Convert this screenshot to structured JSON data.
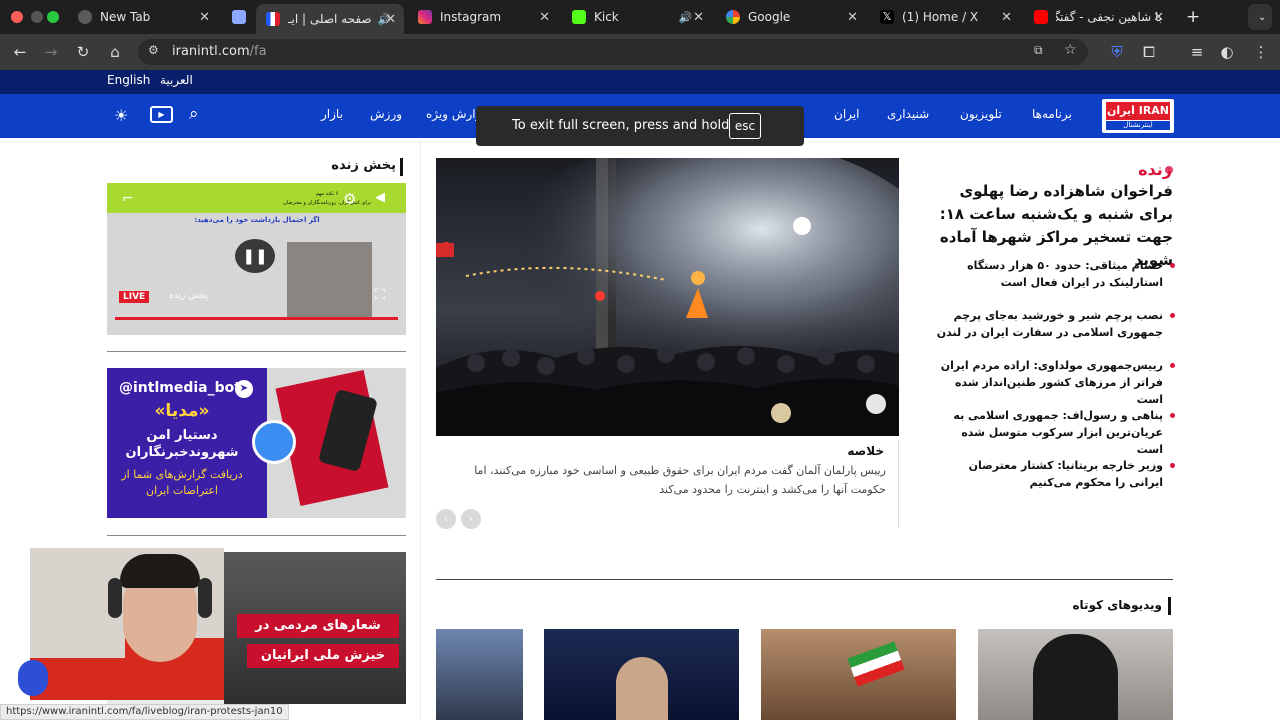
{
  "browser": {
    "tabs": [
      {
        "title": "New Tab",
        "active": false
      },
      {
        "title": "",
        "active": false
      },
      {
        "title": "صفحه اصلی | ایـ",
        "active": true
      },
      {
        "title": "Instagram",
        "active": false
      },
      {
        "title": "Kick",
        "active": false
      },
      {
        "title": "Google",
        "active": false
      },
      {
        "title": "(1) Home / X",
        "active": false
      },
      {
        "title": "با شاهین نجفی - گفتگ",
        "active": false
      }
    ],
    "url_host": "iranintl.com",
    "url_path": "/fa",
    "status_url": "https://www.iranintl.com/fa/liveblog/iran-protests-jan10"
  },
  "site": {
    "langs": [
      "English",
      "العربية"
    ],
    "nav": [
      "برنامه‌ها",
      "تلویزیون",
      "شنیداری",
      "ایران",
      "گزارش ویژه",
      "ورزش",
      "بازار"
    ],
    "logo_top": "ایران IRAN",
    "logo_bottom": "اینترنشنال"
  },
  "fullscreen_toast": {
    "text": "To exit full screen, press and hold",
    "key": "esc"
  },
  "live": {
    "label": "زنده",
    "headline": "فراخوان شاهزاده رضا پهلوی برای شنبه و یک‌شنبه ساعت ۱۸: جهت تسخیر مراکز شهرها آماده شوید",
    "bullets": [
      "حسام میثاقی: حدود ۵۰ هزار دستگاه استارلینک در ایران فعال است",
      "نصب پرچم شیر و خورشید به‌جای پرچم جمهوری اسلامی در سفارت ایران در لندن",
      "رییس‌جمهوری مولداوی: اراده مردم ایران فراتر از مرزهای کشور طنین‌انداز شده است",
      "پناهی و رسول‌اف: جمهوری اسلامی به عریان‌ترین ابزار سرکوب متوسل شده است",
      "وزیر خارجه بریتانیا: کشتار معترضان ایرانی را محکوم می‌کنیم"
    ]
  },
  "main": {
    "summary_title": "خلاصه",
    "summary": "رییس پارلمان آلمان گفت مردم ایران برای حقوق طبیعی و اساسی خود مبارزه می‌کنند، اما حکومت آنها را می‌کشد و اینترنت را محدود می‌کند"
  },
  "left": {
    "live_stream_title": "پخش زنده",
    "player_live_badge": "LIVE",
    "player_caption": "پخش زنده",
    "player_top_line1": "۶ نکته مهم",
    "player_top_line2": "برای کنش‌گران، روزنامه‌نگاران و معترضان",
    "player_top_line3": "اگر احتمال بازداشت خود را می‌دهید:",
    "promo_handle": "@intlmedia_bot",
    "promo_title": "«مدیا»",
    "promo_line1": "دستیار امن",
    "promo_line2": "شهروندخبرنگاران",
    "promo_line3": "دریافت گزارش‌های شما از",
    "promo_line4": "اعتراضات ایران",
    "promo2_line1": "شعارهای مردمی در",
    "promo2_line2": "خیزش ملی ایرانیان"
  },
  "shorts": {
    "title": "ویدیوهای کوتاه"
  },
  "colors": {
    "nav_blue": "#0d3fc7",
    "top_navy": "#0a1f6b",
    "live_red": "#d9123a",
    "promo_purple": "#3b1fa6",
    "promo_red": "#c8102e"
  }
}
